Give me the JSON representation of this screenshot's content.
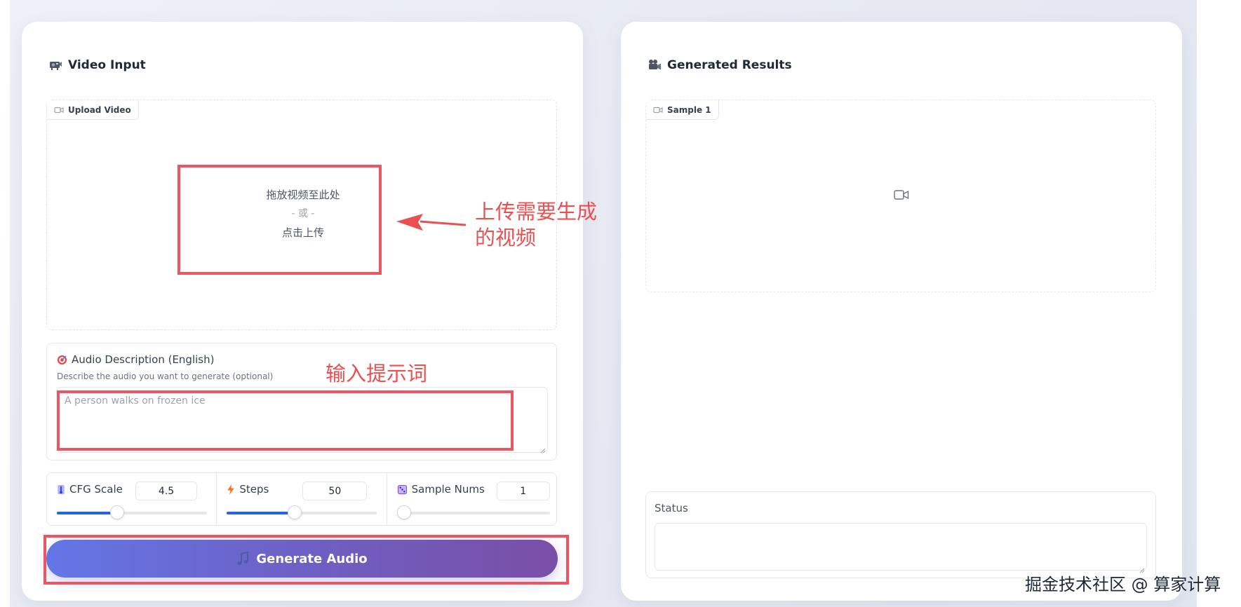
{
  "video_input": {
    "title": "Video Input",
    "upload_label": "Upload Video",
    "drop_text": "拖放视频至此处",
    "or_text": "- 或 -",
    "click_text": "点击上传"
  },
  "audio_desc": {
    "label": "Audio Description (English)",
    "info": "Describe the audio you want to generate (optional)",
    "placeholder": "A person walks on frozen ice"
  },
  "params": {
    "cfg": {
      "label": "CFG Scale",
      "value": "4.5",
      "level": 0.4
    },
    "steps": {
      "label": "Steps",
      "value": "50",
      "level": 0.45
    },
    "samples": {
      "label": "Sample Nums",
      "value": "1",
      "level": 0.0
    }
  },
  "generate_button": {
    "label": "Generate Audio"
  },
  "results": {
    "title": "Generated Results",
    "sample_label": "Sample 1",
    "status_label": "Status"
  },
  "annotations": {
    "upload_note_1": "上传需要生成",
    "upload_note_2": "的视频",
    "prompt_note": "输入提示词"
  },
  "watermark": "掘金技术社区 @ 算家计算",
  "colors": {
    "accent": "#2563eb",
    "annotation": "#ea5050",
    "button_start": "#6376e6",
    "button_end": "#7a4ea6"
  },
  "icons": {
    "video_input": "projector-icon",
    "results": "movie-camera-icon",
    "audio_desc": "target-icon",
    "cfg": "thermometer-icon",
    "steps": "lightning-icon",
    "samples": "dice-icon",
    "generate": "music-note-icon"
  }
}
